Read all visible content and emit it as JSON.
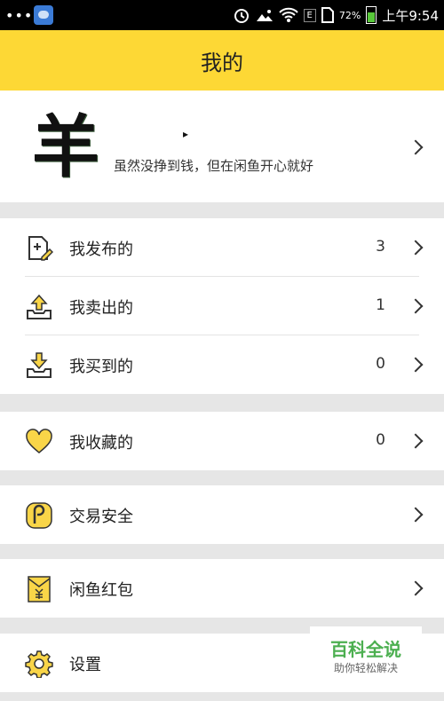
{
  "status_bar": {
    "dots": "•••",
    "network_label": "E",
    "battery_percent": "72%",
    "time": "上午9:54"
  },
  "header": {
    "title": "我的"
  },
  "profile": {
    "avatar_text": "羊",
    "name": "▸",
    "bio": "虽然没挣到钱，但在闲鱼开心就好"
  },
  "menu_groups": [
    [
      {
        "label": "我发布的",
        "count": "3",
        "icon": "publish-icon"
      },
      {
        "label": "我卖出的",
        "count": "1",
        "icon": "sold-icon"
      },
      {
        "label": "我买到的",
        "count": "0",
        "icon": "bought-icon"
      }
    ],
    [
      {
        "label": "我收藏的",
        "count": "0",
        "icon": "heart-icon"
      }
    ],
    [
      {
        "label": "交易安全",
        "icon": "safety-icon"
      }
    ],
    [
      {
        "label": "闲鱼红包",
        "icon": "red-envelope-icon"
      }
    ],
    [
      {
        "label": "设置",
        "icon": "gear-icon"
      }
    ]
  ],
  "watermark": {
    "title": "百科全说",
    "subtitle": "助你轻松解决"
  },
  "colors": {
    "header": "#fdd835",
    "icon_yellow": "#f9d548",
    "background": "#e6e6e6"
  }
}
